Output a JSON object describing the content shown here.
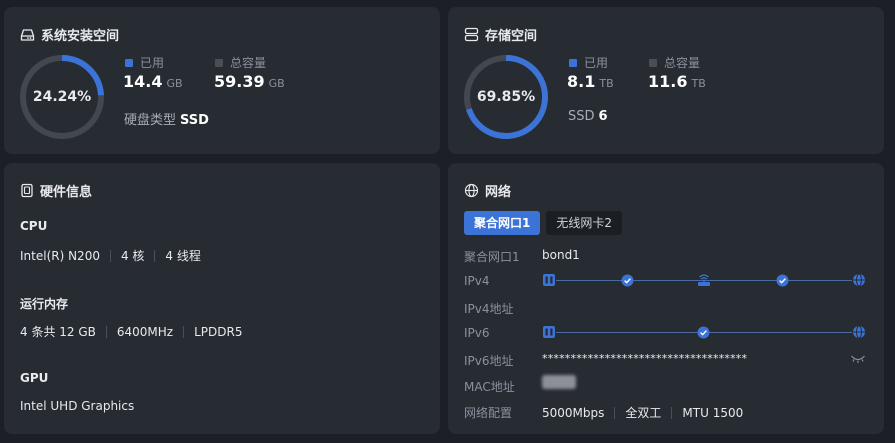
{
  "system_space": {
    "title": "系统安装空间",
    "percent_text": "24.24%",
    "percent": 24.24,
    "used_label": "已用",
    "used_value": "14.4",
    "used_unit": "GB",
    "total_label": "总容量",
    "total_value": "59.39",
    "total_unit": "GB",
    "disk_type_label": "硬盘类型",
    "disk_type_value": "SSD"
  },
  "storage_space": {
    "title": "存储空间",
    "percent_text": "69.85%",
    "percent": 69.85,
    "used_label": "已用",
    "used_value": "8.1",
    "used_unit": "TB",
    "total_label": "总容量",
    "total_value": "11.6",
    "total_unit": "TB",
    "ssd_label": "SSD",
    "ssd_value": "6"
  },
  "hardware": {
    "title": "硬件信息",
    "cpu_label": "CPU",
    "cpu_model": "Intel(R) N200",
    "cpu_cores": "4 核",
    "cpu_threads": "4 线程",
    "memory_label": "运行内存",
    "memory_modules": "4 条共 12 GB",
    "memory_speed": "6400MHz",
    "memory_type": "LPDDR5",
    "gpu_label": "GPU",
    "gpu_model": "Intel UHD Graphics"
  },
  "network": {
    "title": "网络",
    "tabs": [
      {
        "label": "聚合网口1",
        "active": true
      },
      {
        "label": "无线网卡2",
        "active": false
      }
    ],
    "interface_label": "聚合网口1",
    "interface_value": "bond1",
    "ipv4_label": "IPv4",
    "ipv4_address_label": "IPv4地址",
    "ipv6_label": "IPv6",
    "ipv6_address_label": "IPv6地址",
    "ipv6_address_value": "************************************",
    "mac_label": "MAC地址",
    "config_label": "网络配置",
    "speed": "5000Mbps",
    "duplex": "全双工",
    "mtu": "MTU 1500"
  },
  "colors": {
    "accent": "#3c73d6",
    "track": "#43474f",
    "card": "#272b32",
    "background": "#1c1f25"
  }
}
